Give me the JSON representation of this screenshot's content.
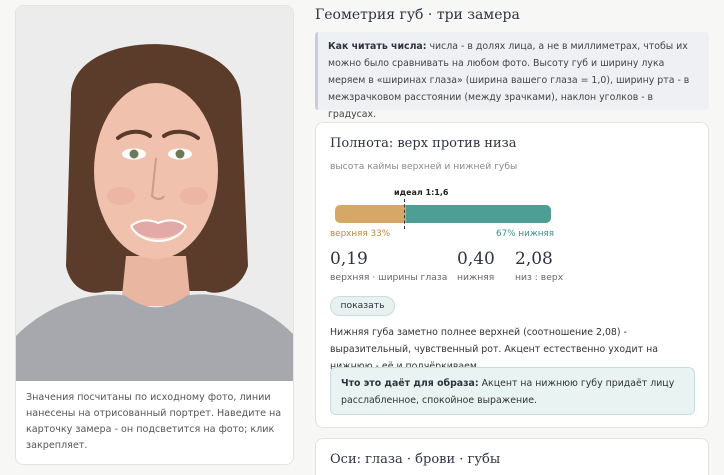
{
  "photo_card": {
    "caption": "Значения посчитаны по исходному фото, линии нанесены на отрисованный портрет. Наведите на карточку замера - он подсветится на фото; клик закрепляет."
  },
  "header": {
    "title": "Геометрия губ · три замера"
  },
  "info": {
    "bold": "Как читать числа:",
    "text": " числа - в долях лица, а не в миллиметрах, чтобы их можно было сравнивать на любом фото. Высоту губ и ширину лука меряем в «ширинах глаза» (ширина вашего глаза = 1,0), ширину рта - в межзрачковом расстоянии (между зрачками), наклон уголков - в градусах."
  },
  "fullness": {
    "title": "Полнота: верх против низа",
    "subtitle": "высота каймы верхней и нижней губы",
    "ideal_label": "идеал 1:1,6",
    "top_share": 0.33,
    "bottom_share": 0.67,
    "top_color": "#d6a867",
    "bottom_color": "#4e9e95",
    "top_label": "верхняя 33%",
    "bottom_label": "67% нижняя",
    "metrics": [
      {
        "value": "0,19",
        "label": "верхняя · ширины глаза"
      },
      {
        "value": "0,40",
        "label": "нижняя"
      },
      {
        "value": "2,08",
        "label": "низ : верх"
      }
    ],
    "show_button": "показать",
    "description": "Нижняя губа заметно полнее верхней (соотношение 2,08) - выразительный, чувственный рот. Акцент естественно уходит на нижнюю - её и подчёркиваем.",
    "hint_bold": "Что это даёт для образа:",
    "hint_text": " Акцент на нижнюю губу придаёт лицу расслабленное, спокойное выражение."
  },
  "axes_card": {
    "title": "Оси: глаза · брови · губы"
  }
}
